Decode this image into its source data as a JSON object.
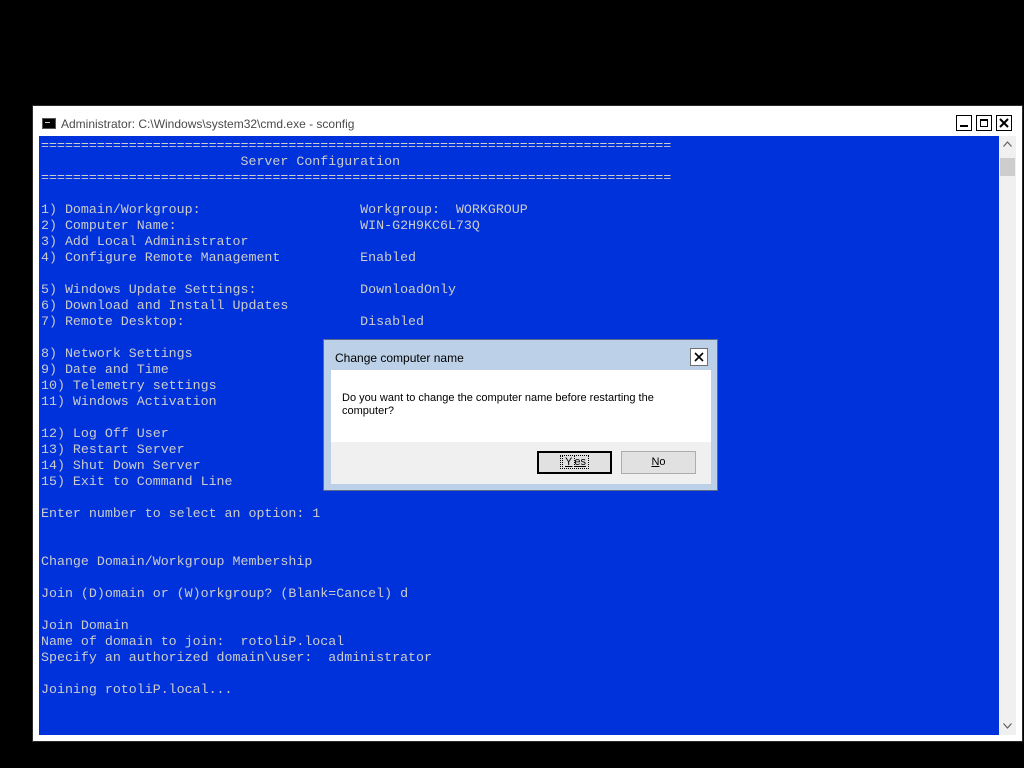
{
  "window": {
    "title": "Administrator: C:\\Windows\\system32\\cmd.exe - sconfig"
  },
  "console": {
    "lines": [
      "===============================================================================",
      "                         Server Configuration",
      "===============================================================================",
      "",
      "1) Domain/Workgroup:                    Workgroup:  WORKGROUP",
      "2) Computer Name:                       WIN-G2H9KC6L73Q",
      "3) Add Local Administrator",
      "4) Configure Remote Management          Enabled",
      "",
      "5) Windows Update Settings:             DownloadOnly",
      "6) Download and Install Updates",
      "7) Remote Desktop:                      Disabled",
      "",
      "8) Network Settings",
      "9) Date and Time",
      "10) Telemetry settings",
      "11) Windows Activation",
      "",
      "12) Log Off User",
      "13) Restart Server",
      "14) Shut Down Server",
      "15) Exit to Command Line",
      "",
      "Enter number to select an option: 1",
      "",
      "",
      "Change Domain/Workgroup Membership",
      "",
      "Join (D)omain or (W)orkgroup? (Blank=Cancel) d",
      "",
      "Join Domain",
      "Name of domain to join:  rotoliP.local",
      "Specify an authorized domain\\user:  administrator",
      "",
      "Joining rotoliP.local..."
    ]
  },
  "dialog": {
    "title": "Change computer name",
    "message": "Do you want to change the computer name before restarting the computer?",
    "yes_key": "Y",
    "yes_rest": "es",
    "no_key": "N",
    "no_rest": "o"
  },
  "colors": {
    "console_bg": "#0032dc",
    "console_fg": "#cccccc"
  }
}
